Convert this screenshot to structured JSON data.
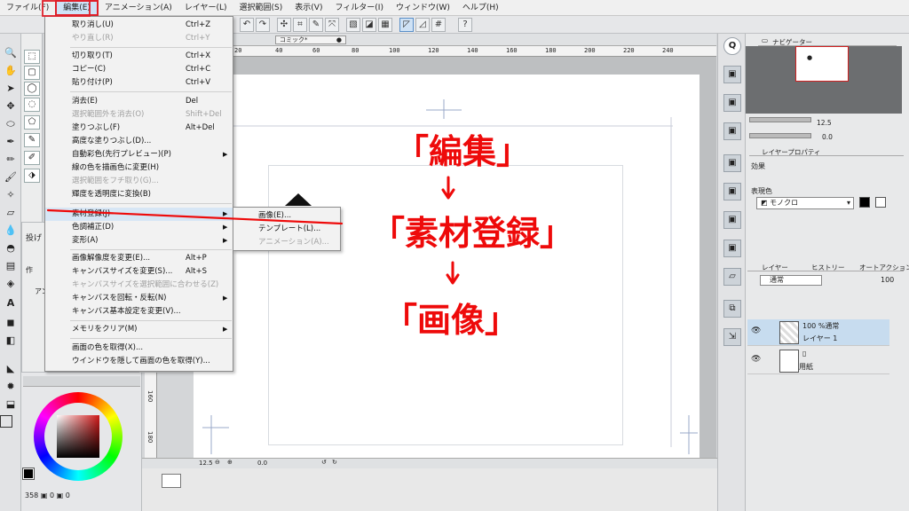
{
  "menubar": {
    "items": [
      "ファイル(F)",
      "編集(E)",
      "アニメーション(A)",
      "レイヤー(L)",
      "選択範囲(S)",
      "表示(V)",
      "フィルター(I)",
      "ウィンドウ(W)",
      "ヘルプ(H)"
    ]
  },
  "edit_menu": {
    "undo": {
      "label": "取り消し(U)",
      "shortcut": "Ctrl+Z"
    },
    "redo": {
      "label": "やり直し(R)",
      "shortcut": "Ctrl+Y"
    },
    "cut": {
      "label": "切り取り(T)",
      "shortcut": "Ctrl+X"
    },
    "copy": {
      "label": "コピー(C)",
      "shortcut": "Ctrl+C"
    },
    "paste": {
      "label": "貼り付け(P)",
      "shortcut": "Ctrl+V"
    },
    "clear": {
      "label": "消去(E)",
      "shortcut": "Del"
    },
    "clear_outside": {
      "label": "選択範囲外を消去(O)",
      "shortcut": "Shift+Del"
    },
    "fill": {
      "label": "塗りつぶし(F)",
      "shortcut": "Alt+Del"
    },
    "advanced_fill": {
      "label": "高度な塗りつぶし(D)..."
    },
    "auto_color": {
      "label": "自動彩色(先行プレビュー)(P)"
    },
    "line_color": {
      "label": "線の色を描画色に変更(H)"
    },
    "border_selection": {
      "label": "選択範囲をフチ取り(G)..."
    },
    "brightness_alpha": {
      "label": "輝度を透明度に変換(B)"
    },
    "register_material": {
      "label": "素材登録(J)"
    },
    "tonal_correction": {
      "label": "色調補正(D)"
    },
    "transform": {
      "label": "変形(A)"
    },
    "change_resolution": {
      "label": "画像解像度を変更(E)...",
      "shortcut": "Alt+P"
    },
    "change_canvas_size": {
      "label": "キャンバスサイズを変更(S)...",
      "shortcut": "Alt+S"
    },
    "fit_canvas": {
      "label": "キャンバスサイズを選択範囲に合わせる(Z)"
    },
    "rotate_canvas": {
      "label": "キャンバスを回転・反転(N)"
    },
    "canvas_basic": {
      "label": "キャンバス基本設定を変更(V)..."
    },
    "clear_memory": {
      "label": "メモリをクリア(M)"
    },
    "get_screen_color": {
      "label": "画面の色を取得(X)..."
    },
    "hide_get_color": {
      "label": "ウインドウを隠して画面の色を取得(Y)..."
    }
  },
  "submenu": {
    "image": "画像(E)...",
    "template": "テンプレート(L)...",
    "animation": "アニメーション(A)..."
  },
  "document": {
    "tab": "コミック*",
    "ruler_ticks": [
      "20",
      "40",
      "60",
      "80",
      "100",
      "120",
      "140",
      "160",
      "180",
      "200",
      "220",
      "240"
    ],
    "ruler_left": [
      "160",
      "180"
    ],
    "zoom": "12.5",
    "angle": "0.0"
  },
  "tool_panel": {
    "tab_label": "アン",
    "label_a": "作",
    "label_b": "投げ"
  },
  "color": {
    "readout_a": "358",
    "readout_b": "0",
    "readout_c": "0",
    "main_color": "#000000",
    "sub_color": "#ffffff"
  },
  "navigator": {
    "tab": "ナビゲーター",
    "zoom": "12.5",
    "angle": "0.0"
  },
  "layer_property": {
    "tab": "レイヤープロパティ",
    "effect_label": "効果",
    "expression_label": "表現色",
    "expression_value": "モノクロ"
  },
  "layers": {
    "tab_layer": "レイヤー",
    "tab_history": "ヒストリー",
    "tab_autoaction": "オートアクション",
    "blend_mode": "通常",
    "opacity": "100",
    "rows": [
      {
        "line1": "100 %通常",
        "line2": "レイヤー 1"
      },
      {
        "line1": "",
        "line2": "用紙"
      }
    ]
  },
  "annotation": {
    "step1": "「編集」",
    "step2": "「素材登録」",
    "step3": "「画像」",
    "color": "#ee0a0a"
  }
}
